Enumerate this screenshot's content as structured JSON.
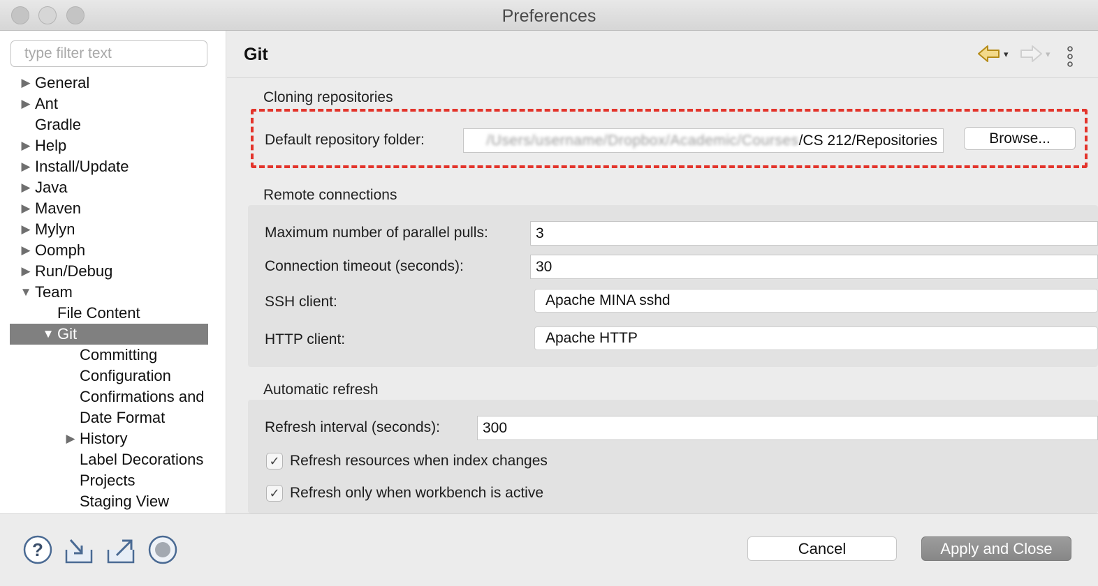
{
  "window": {
    "title": "Preferences"
  },
  "filter": {
    "placeholder": "type filter text"
  },
  "tree": {
    "nodes": [
      {
        "label": "General",
        "arrow": "▶"
      },
      {
        "label": "Ant",
        "arrow": "▶"
      },
      {
        "label": "Gradle",
        "arrow": ""
      },
      {
        "label": "Help",
        "arrow": "▶"
      },
      {
        "label": "Install/Update",
        "arrow": "▶"
      },
      {
        "label": "Java",
        "arrow": "▶"
      },
      {
        "label": "Maven",
        "arrow": "▶"
      },
      {
        "label": "Mylyn",
        "arrow": "▶"
      },
      {
        "label": "Oomph",
        "arrow": "▶"
      },
      {
        "label": "Run/Debug",
        "arrow": "▶"
      },
      {
        "label": "Team",
        "arrow": "▼"
      },
      {
        "label": "File Content",
        "arrow": ""
      },
      {
        "label": "Git",
        "arrow": "▼"
      },
      {
        "label": "Committing",
        "arrow": ""
      },
      {
        "label": "Configuration",
        "arrow": ""
      },
      {
        "label": "Confirmations and",
        "arrow": ""
      },
      {
        "label": "Date Format",
        "arrow": ""
      },
      {
        "label": "History",
        "arrow": "▶"
      },
      {
        "label": "Label Decorations",
        "arrow": ""
      },
      {
        "label": "Projects",
        "arrow": ""
      },
      {
        "label": "Staging View",
        "arrow": ""
      }
    ]
  },
  "page": {
    "title": "Git",
    "nav": {
      "back_icon": "back-arrow-icon",
      "forward_icon": "forward-arrow-icon",
      "dropdown_glyph": "▾"
    },
    "cloning": {
      "title": "Cloning repositories",
      "folder_label": "Default repository folder:",
      "folder_value_visible": "/CS 212/Repositories",
      "folder_value_blurred": "/Users/username/Dropbox/Academic/Courses",
      "browse_label": "Browse..."
    },
    "remote": {
      "title": "Remote connections",
      "pulls_label": "Maximum number of parallel pulls:",
      "pulls_value": "3",
      "timeout_label": "Connection timeout (seconds):",
      "timeout_value": "30",
      "ssh_label": "SSH client:",
      "ssh_value": "Apache MINA sshd",
      "http_label": "HTTP client:",
      "http_value": "Apache HTTP"
    },
    "refresh": {
      "title": "Automatic refresh",
      "interval_label": "Refresh interval (seconds):",
      "interval_value": "300",
      "index_changes_label": "Refresh resources when index changes",
      "index_changes_checked": true,
      "workbench_active_label": "Refresh only when workbench is active",
      "workbench_active_checked": true,
      "check_glyph": "✓"
    }
  },
  "footer": {
    "cancel_label": "Cancel",
    "apply_label": "Apply and Close"
  },
  "colors": {
    "highlight": "#e3342b",
    "selection": "#808080",
    "apply_button": "#8f8f8f"
  }
}
